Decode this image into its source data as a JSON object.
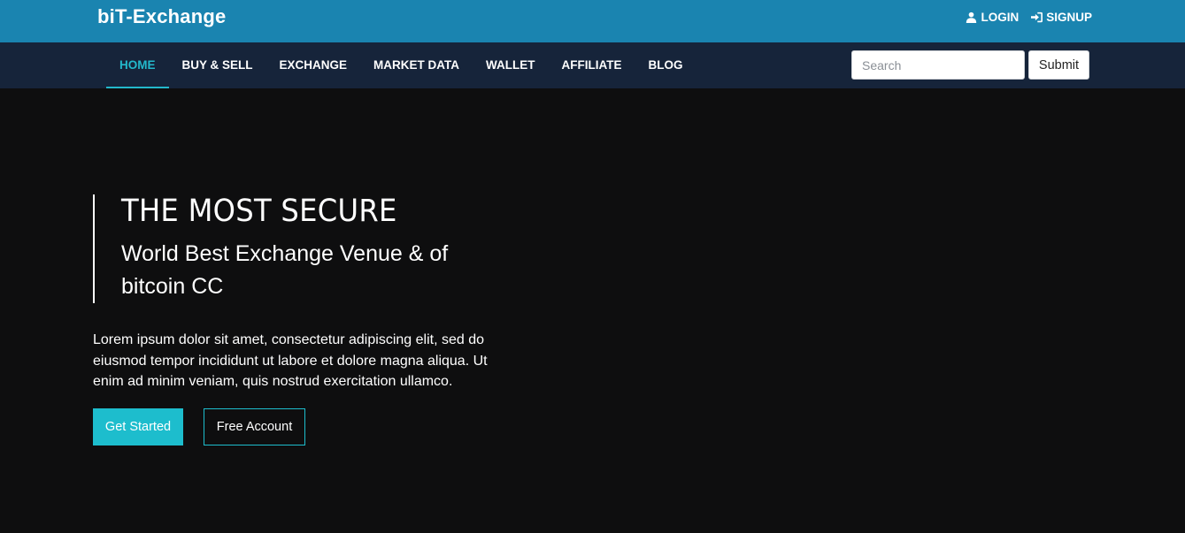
{
  "header": {
    "logo": "biT-Exchange",
    "login_label": "LOGIN",
    "signup_label": "SIGNUP"
  },
  "nav": {
    "items": [
      {
        "label": "HOME",
        "active": true
      },
      {
        "label": "BUY & SELL"
      },
      {
        "label": "EXCHANGE"
      },
      {
        "label": "MARKET DATA"
      },
      {
        "label": "WALLET"
      },
      {
        "label": "AFFILIATE"
      },
      {
        "label": "BLOG"
      }
    ],
    "search_placeholder": "Search",
    "search_value": "",
    "submit_label": "Submit"
  },
  "hero": {
    "headline": "THE MOST SECURE",
    "subheadline": "World Best Exchange Venue & of bitcoin CC",
    "description": "Lorem ipsum dolor sit amet, consectetur adipiscing elit, sed do eiusmod tempor incididunt ut labore et dolore magna aliqua. Ut enim ad minim veniam, quis nostrud exercitation ullamco.",
    "primary_button": "Get Started",
    "secondary_button": "Free Account"
  },
  "colors": {
    "topbar": "#1a84b0",
    "navbar": "#16243a",
    "background": "#0e0e0f",
    "accent": "#1dbdcd"
  },
  "icons": {
    "login": "user-icon",
    "signup": "sign-in-icon"
  }
}
